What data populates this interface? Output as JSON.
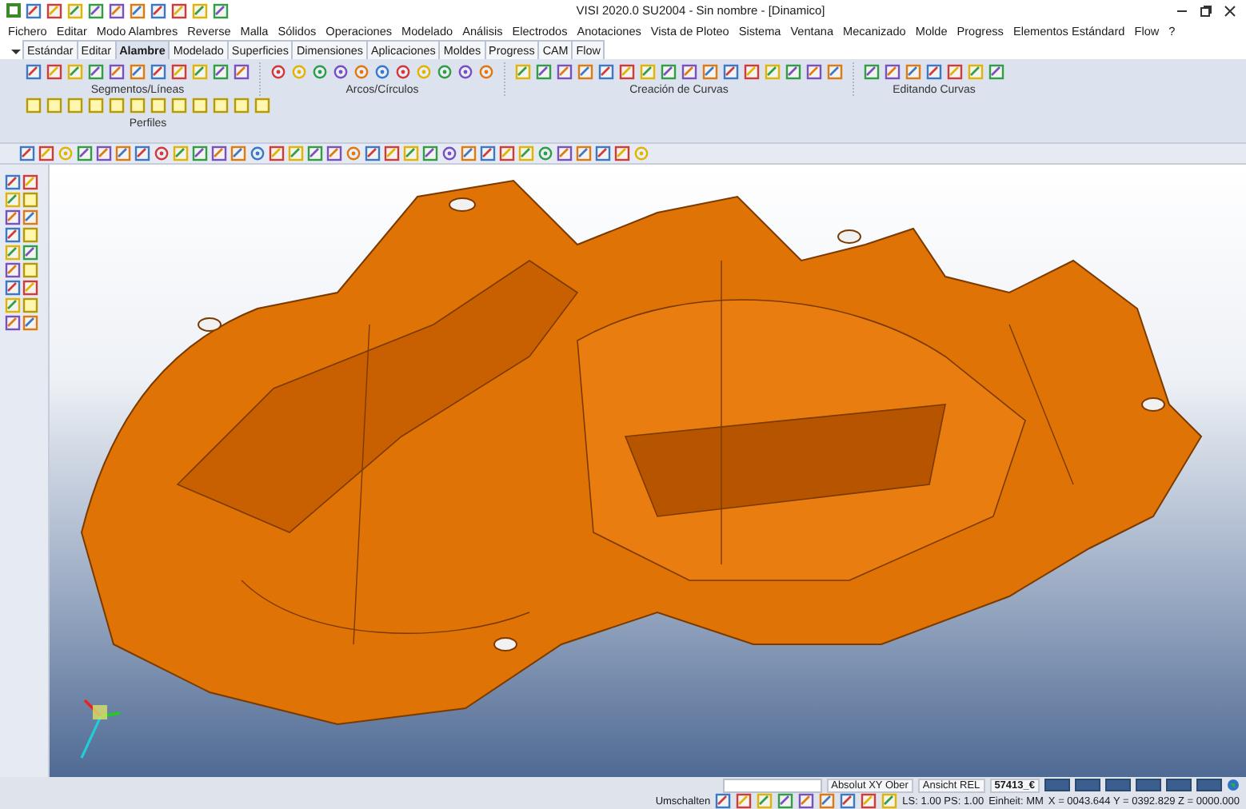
{
  "window": {
    "title": "VISI 2020.0 SU2004 - Sin nombre - [Dinamico]"
  },
  "menu": [
    "Fichero",
    "Editar",
    "Modo Alambres",
    "Reverse",
    "Malla",
    "Sólidos",
    "Operaciones",
    "Modelado",
    "Análisis",
    "Electrodos",
    "Anotaciones",
    "Vista de Ploteo",
    "Sistema",
    "Ventana",
    "Mecanizado",
    "Molde",
    "Progress",
    "Elementos Estándard",
    "Flow",
    "?"
  ],
  "tabs": [
    {
      "label": "Estándar",
      "selected": false
    },
    {
      "label": "Editar",
      "selected": false
    },
    {
      "label": "Alambre",
      "selected": true
    },
    {
      "label": "Modelado",
      "selected": false
    },
    {
      "label": "Superficies",
      "selected": false
    },
    {
      "label": "Dimensiones",
      "selected": false
    },
    {
      "label": "Aplicaciones",
      "selected": false
    },
    {
      "label": "Moldes",
      "selected": false
    },
    {
      "label": "Progress",
      "selected": false
    },
    {
      "label": "CAM",
      "selected": false
    },
    {
      "label": "Flow",
      "selected": false
    }
  ],
  "ribbon_groups": [
    {
      "label": "Segmentos/Líneas"
    },
    {
      "label": "Arcos/Círculos"
    },
    {
      "label": "Creación de Curvas"
    },
    {
      "label": "Editando Curvas"
    }
  ],
  "ribbon_row2": {
    "label": "Perfiles"
  },
  "status_bar": {
    "view_mode": "Absolut XY Ober",
    "view_ref": "Ansicht REL",
    "file": "57413_€",
    "toggle": "Umschalten",
    "scale": "LS: 1.00 PS: 1.00",
    "unit": "Einheit: MM",
    "coords": "X = 0043.644 Y = 0392.829 Z = 0000.000"
  }
}
